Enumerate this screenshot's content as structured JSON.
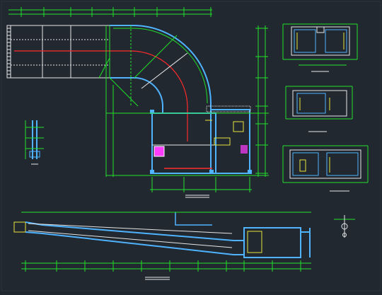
{
  "drawing": {
    "background": "#212830",
    "colors": {
      "green": "#22e02a",
      "cyan": "#4fb3ff",
      "red": "#ff2a2a",
      "white": "#e6e6e6",
      "yellow": "#e6e23a",
      "magenta": "#ff3cff"
    },
    "view_titles": {
      "plan": "",
      "profile": "",
      "section_1": "",
      "section_2": "",
      "section_3": "",
      "detail": ""
    },
    "plan_label": "",
    "detail_icon": "north-arrow-icon"
  }
}
